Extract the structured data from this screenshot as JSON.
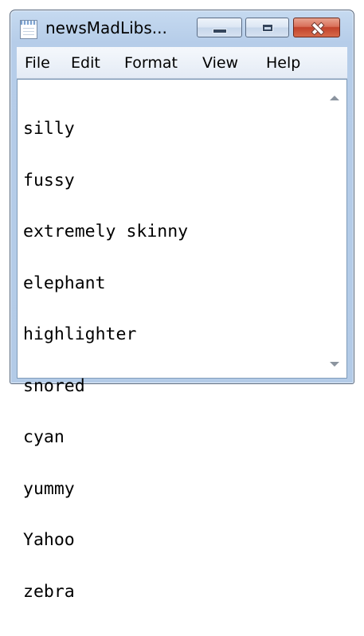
{
  "window": {
    "title": "newsMadLibs...",
    "icon": "notepad-icon"
  },
  "controls": {
    "minimize_icon": "minimize-icon",
    "maximize_icon": "maximize-icon",
    "close_icon": "close-icon"
  },
  "menu": {
    "items": [
      {
        "label": "File"
      },
      {
        "label": "Edit"
      },
      {
        "label": "Format"
      },
      {
        "label": "View"
      },
      {
        "label": "Help"
      }
    ]
  },
  "editor": {
    "lines": [
      "silly",
      "fussy",
      "extremely skinny",
      "elephant",
      "highlighter",
      "snored",
      "cyan",
      "yummy",
      "Yahoo",
      "zebra"
    ]
  },
  "colors": {
    "close_button": "#c2422b",
    "frame": "#b6cde9"
  }
}
